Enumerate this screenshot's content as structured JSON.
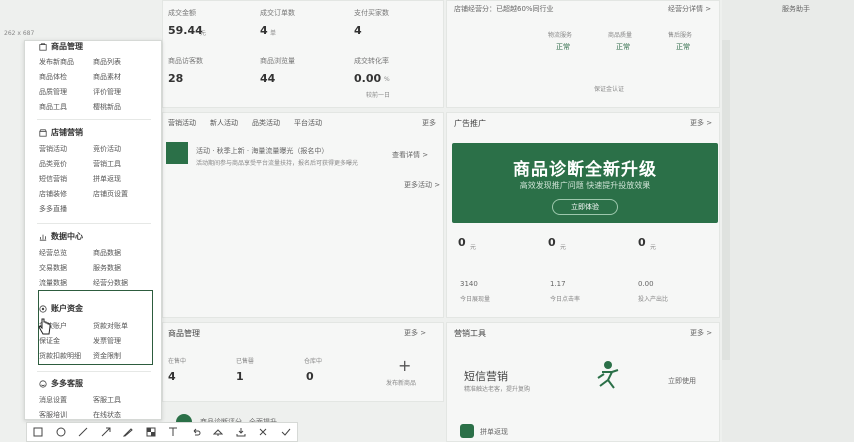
{
  "top_metrics": {
    "row1": [
      {
        "label": "成交金额",
        "value": "59.44",
        "unit": "元"
      },
      {
        "label": "成交订单数",
        "value": "4",
        "unit": "单"
      },
      {
        "label": "支付买家数",
        "value": "4",
        "unit": ""
      }
    ],
    "row2": [
      {
        "label": "商品访客数",
        "value": "28",
        "unit": ""
      },
      {
        "label": "商品浏览量",
        "value": "44",
        "unit": ""
      },
      {
        "label": "成交转化率",
        "value": "0.00",
        "unit": "%",
        "sub": "较前一日"
      }
    ]
  },
  "store_status": {
    "title": "店铺经营分：已超越60%同行业",
    "link": "经营分详情 >",
    "scores": [
      "正常",
      "正常",
      "正常"
    ],
    "score_labels": [
      "物流服务",
      "商品质量",
      "售后服务"
    ],
    "extra": "保证金认证"
  },
  "right_panel": {
    "title": "服务助手"
  },
  "tabs": [
    "营销活动",
    "新人活动",
    "品类活动",
    "平台活动"
  ],
  "tabs_more": "更多",
  "promo": {
    "title": "活动 · 秋季上新 · 海量流量曝光（报名中）",
    "desc": "活动期间参与商品享受平台流量扶持，报名后可获得更多曝光",
    "link": "查看详情 >",
    "more": "更多活动 >"
  },
  "ad": {
    "title": "广告推广",
    "more": "更多 >",
    "banner_title": "商品诊断全新升级",
    "banner_sub": "高效发现推广问题 快速提升投放效果",
    "banner_btn": "立即体验",
    "stats": [
      {
        "value": "0",
        "unit": "元"
      },
      {
        "value": "0",
        "unit": "元"
      },
      {
        "value": "0",
        "unit": "元"
      }
    ],
    "stats2": [
      {
        "value": "3140",
        "label": "今日展现量"
      },
      {
        "value": "1.17",
        "label": "今日点击率"
      },
      {
        "value": "0.00",
        "label": "投入产出比"
      }
    ]
  },
  "goods": {
    "title": "商品管理",
    "more": "更多 >",
    "items": [
      {
        "label": "在售中",
        "value": "4"
      },
      {
        "label": "已售罄",
        "value": "1"
      },
      {
        "label": "仓库中",
        "value": "0"
      }
    ],
    "add_label": "发布新商品"
  },
  "marketing_tools": {
    "title": "营销工具",
    "more": "更多 >",
    "sms_title": "短信营销",
    "sms_desc": "精准触达老客，提升复购",
    "sms_btn": "立即使用",
    "next_item": "拼单返现"
  },
  "bottom_partial": {
    "title": "商品诊断评分，全面提升"
  },
  "menu": {
    "size_label": "262 x 687",
    "sections": [
      {
        "title": "商品管理",
        "items": [
          "发布新商品",
          "商品列表",
          "商品体检",
          "商品素材",
          "品质管理",
          "评价管理",
          "商品工具",
          "樱桃新品"
        ]
      },
      {
        "title": "店铺营销",
        "items": [
          "营销活动",
          "竞价活动",
          "品类竞价",
          "营销工具",
          "短信营销",
          "拼单返现",
          "店铺装修",
          "店铺页设置",
          "多多直播"
        ]
      },
      {
        "title": "数据中心",
        "items": [
          "经营总览",
          "商品数据",
          "交易数据",
          "服务数据",
          "流量数据",
          "经营分数据"
        ]
      },
      {
        "title": "账户资金",
        "items": [
          "货款账户",
          "货款对账单",
          "保证金",
          "发票管理",
          "货款扣款明细",
          "资金限制"
        ]
      },
      {
        "title": "多多客服",
        "items": [
          "消息设置",
          "客服工具",
          "客服培训",
          "在线状态"
        ]
      }
    ]
  },
  "toolbar": {
    "tools": [
      "rect",
      "ellipse",
      "line",
      "arrow",
      "pen",
      "mosaic",
      "text",
      "undo",
      "pin",
      "download",
      "close",
      "confirm"
    ]
  },
  "colors": {
    "accent": "#2b7048",
    "highlight": "#2d5c3e"
  }
}
